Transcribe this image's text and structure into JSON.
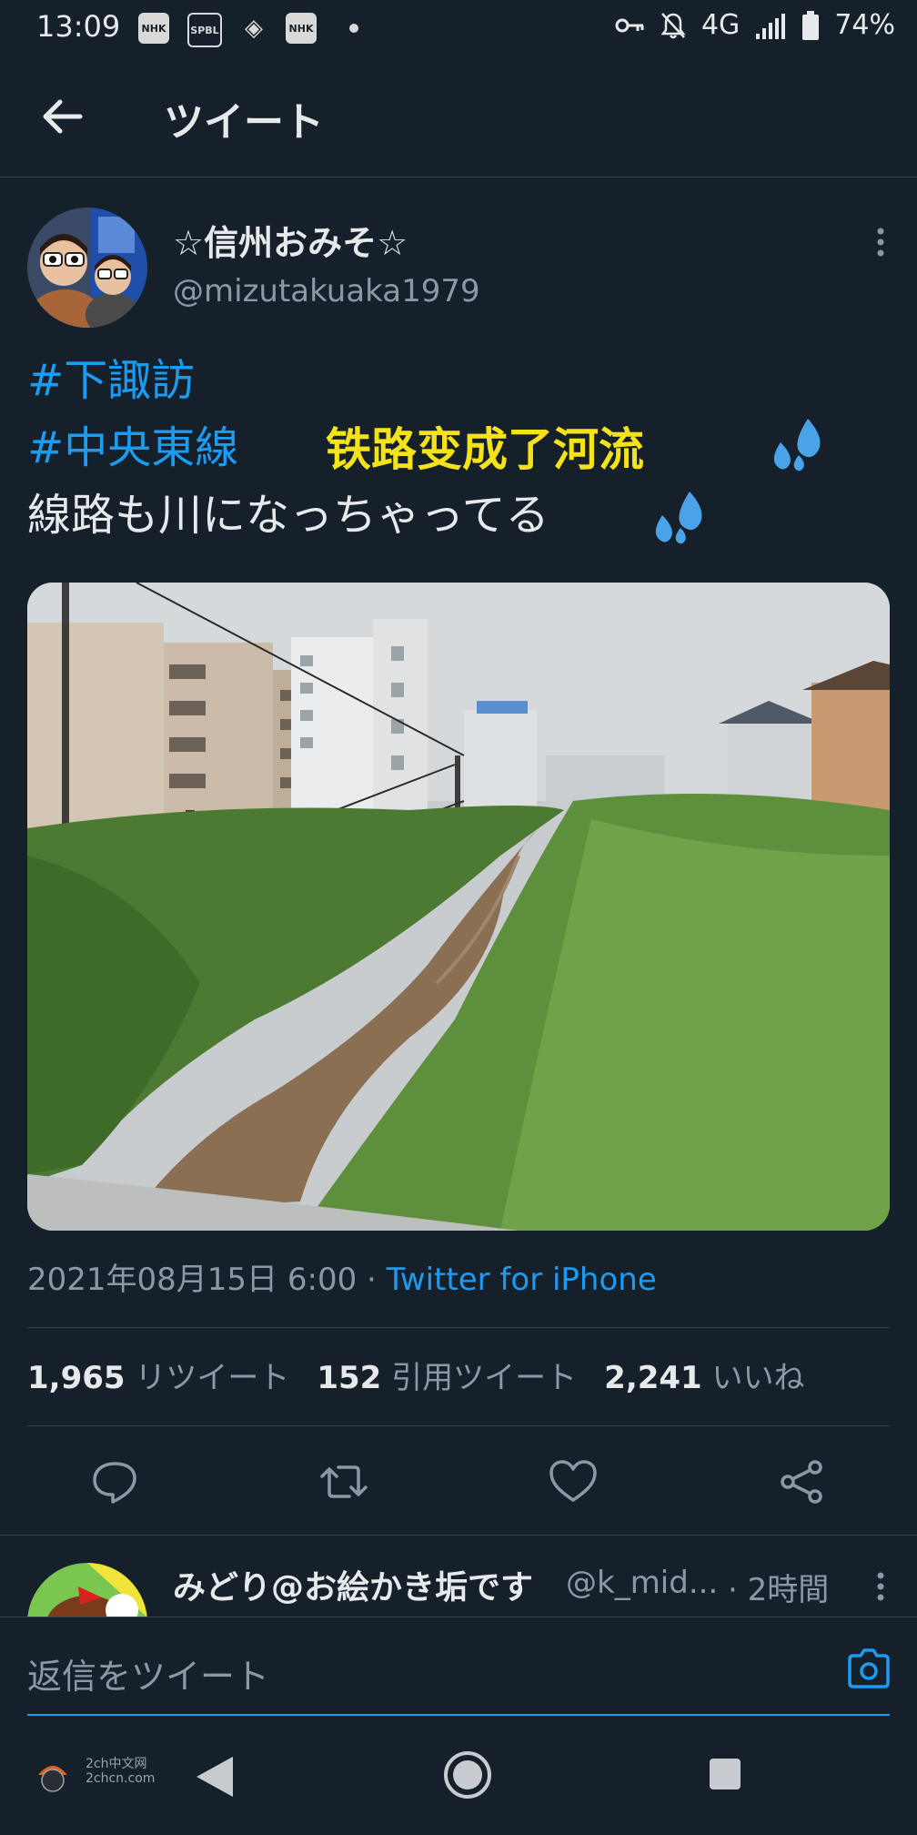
{
  "status_bar": {
    "time": "13:09",
    "left_icons": [
      "NHK",
      "SPBL",
      "◈",
      "NHK"
    ],
    "network": "4G",
    "battery": "74%",
    "icon_names": [
      "key-icon",
      "mute-icon",
      "signal-icon",
      "battery-icon"
    ]
  },
  "header": {
    "title": "ツイート"
  },
  "tweet": {
    "display_name": "☆信州おみそ☆",
    "handle": "@mizutakuaka1979",
    "hashtag1": "#下諏訪",
    "hashtag2": "#中央東線",
    "overlay_text": "铁路变成了河流",
    "body": "線路も川になっちゃってる",
    "emoji": "💦",
    "date": "2021年08月15日 6:00",
    "dot_sep": " · ",
    "source": "Twitter for iPhone",
    "retweets": {
      "count": "1,965",
      "label": "リツイート"
    },
    "quotes": {
      "count": "152",
      "label": "引用ツイート"
    },
    "likes": {
      "count": "2,241",
      "label": "いいね"
    }
  },
  "reply": {
    "display_name": "みどり@お絵かき垢です",
    "handle": "@k_mid...",
    "time": "· 2時間"
  },
  "compose": {
    "placeholder": "返信をツイート"
  },
  "watermark": {
    "line1": "2ch中文网",
    "line2": "2chcn.com"
  },
  "colors": {
    "background": "#15202b",
    "accent": "#1d9bf0",
    "muted": "#8b98a5",
    "overlay": "#f4e21a"
  }
}
